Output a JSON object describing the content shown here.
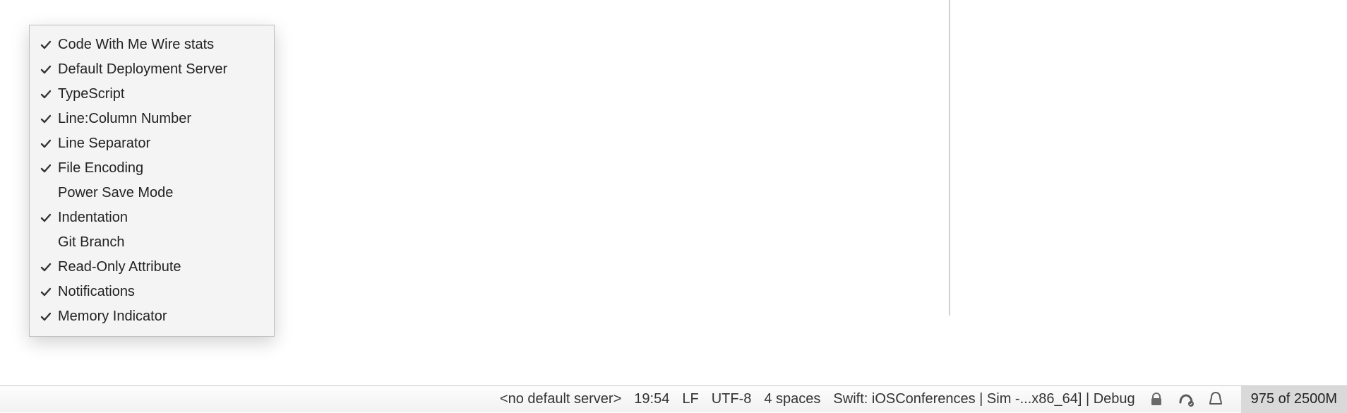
{
  "menu": {
    "items": [
      {
        "label": "Code With Me Wire stats",
        "checked": true
      },
      {
        "label": "Default Deployment Server",
        "checked": true
      },
      {
        "label": "TypeScript",
        "checked": true
      },
      {
        "label": "Line:Column Number",
        "checked": true
      },
      {
        "label": "Line Separator",
        "checked": true
      },
      {
        "label": "File Encoding",
        "checked": true
      },
      {
        "label": "Power Save Mode",
        "checked": false
      },
      {
        "label": "Indentation",
        "checked": true
      },
      {
        "label": "Git Branch",
        "checked": false
      },
      {
        "label": "Read-Only Attribute",
        "checked": true
      },
      {
        "label": "Notifications",
        "checked": true
      },
      {
        "label": "Memory Indicator",
        "checked": true
      }
    ]
  },
  "statusbar": {
    "deployment_server": "<no default server>",
    "line_col": "19:54",
    "line_sep": "LF",
    "encoding": "UTF-8",
    "indent": "4 spaces",
    "swift_context": "Swift: iOSConferences | Sim -...x86_64] | Debug",
    "memory": "975 of 2500M"
  }
}
